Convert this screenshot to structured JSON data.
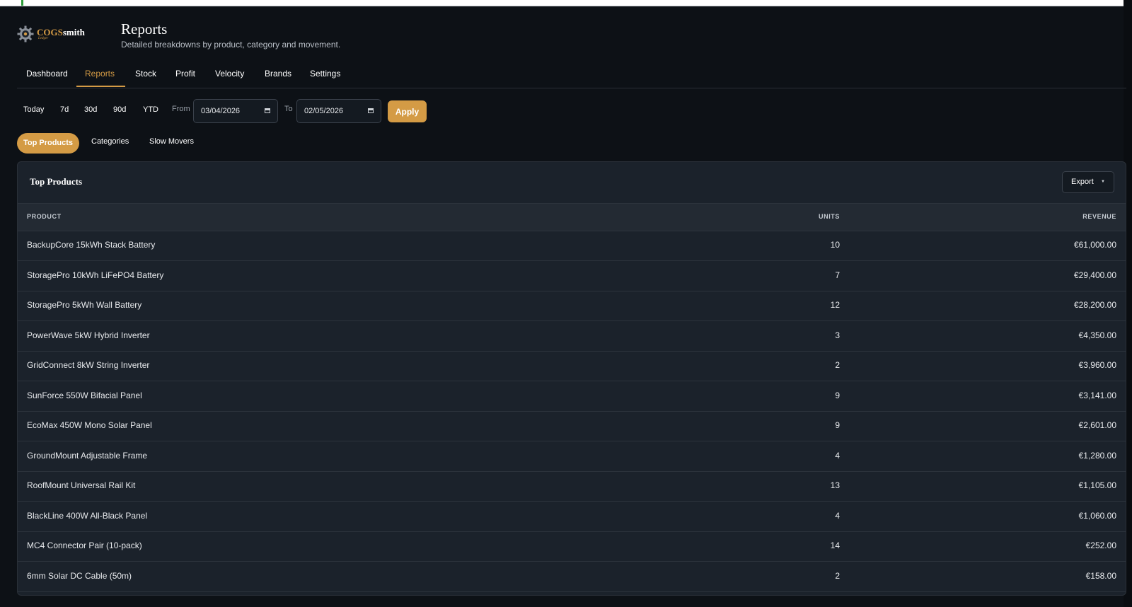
{
  "brand": {
    "name_accent": "COGS",
    "name_rest": "smith",
    "tagline": "Ledger",
    "accent_color": "#d49b45"
  },
  "header": {
    "title": "Reports",
    "subtitle": "Detailed breakdowns by product, category and movement."
  },
  "nav": {
    "items": [
      "Dashboard",
      "Reports",
      "Stock",
      "Profit",
      "Velocity",
      "Brands",
      "Settings"
    ],
    "active": "Reports"
  },
  "filters": {
    "ranges": [
      "Today",
      "7d",
      "30d",
      "90d",
      "YTD"
    ],
    "from_label": "From",
    "from_value": "03/04/2026",
    "to_label": "To",
    "to_value": "02/05/2026",
    "apply_label": "Apply"
  },
  "tabs": {
    "items": [
      "Top Products",
      "Categories",
      "Slow Movers"
    ],
    "active": "Top Products"
  },
  "panel": {
    "title": "Top Products",
    "export_label": "Export",
    "columns": [
      "PRODUCT",
      "UNITS",
      "REVENUE"
    ],
    "rows": [
      {
        "product": "BackupCore 15kWh Stack Battery",
        "units": "10",
        "revenue": "€61,000.00"
      },
      {
        "product": "StoragePro 10kWh LiFePO4 Battery",
        "units": "7",
        "revenue": "€29,400.00"
      },
      {
        "product": "StoragePro 5kWh Wall Battery",
        "units": "12",
        "revenue": "€28,200.00"
      },
      {
        "product": "PowerWave 5kW Hybrid Inverter",
        "units": "3",
        "revenue": "€4,350.00"
      },
      {
        "product": "GridConnect 8kW String Inverter",
        "units": "2",
        "revenue": "€3,960.00"
      },
      {
        "product": "SunForce 550W Bifacial Panel",
        "units": "9",
        "revenue": "€3,141.00"
      },
      {
        "product": "EcoMax 450W Mono Solar Panel",
        "units": "9",
        "revenue": "€2,601.00"
      },
      {
        "product": "GroundMount Adjustable Frame",
        "units": "4",
        "revenue": "€1,280.00"
      },
      {
        "product": "RoofMount Universal Rail Kit",
        "units": "13",
        "revenue": "€1,105.00"
      },
      {
        "product": "BlackLine 400W All-Black Panel",
        "units": "4",
        "revenue": "€1,060.00"
      },
      {
        "product": "MC4 Connector Pair (10-pack)",
        "units": "14",
        "revenue": "€252.00"
      },
      {
        "product": "6mm Solar DC Cable (50m)",
        "units": "2",
        "revenue": "€158.00"
      }
    ]
  }
}
